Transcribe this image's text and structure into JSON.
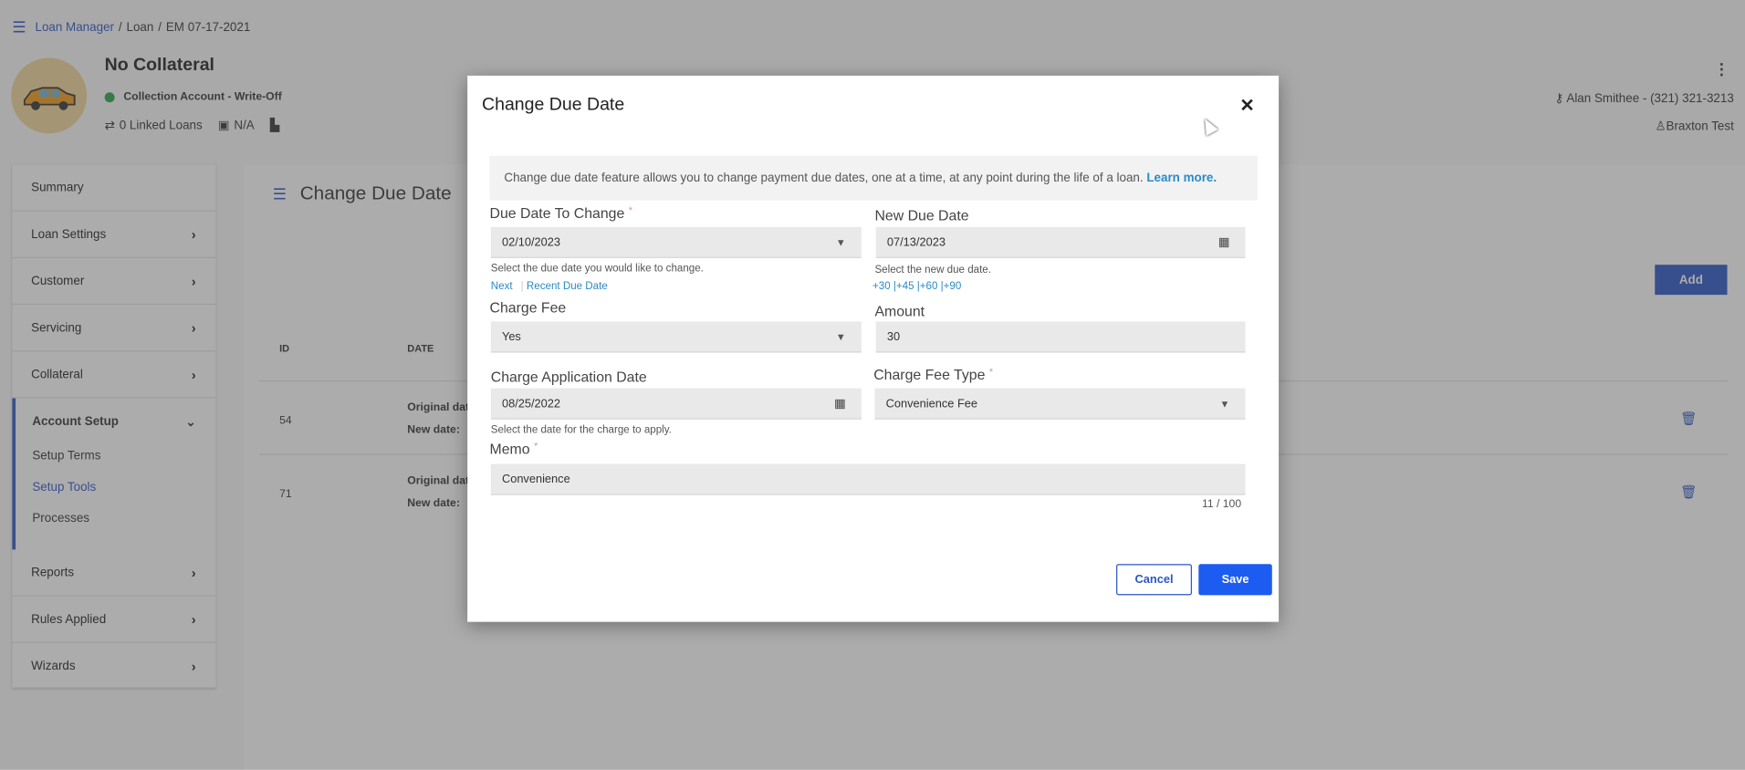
{
  "breadcrumb": {
    "root": "Loan Manager",
    "loan": "Loan",
    "current": "EM 07-17-2021"
  },
  "header": {
    "title": "No Collateral",
    "status": "Collection Account - Write-Off",
    "linked_loans": "0 Linked Loans",
    "date_value": "N/A",
    "owner": "Alan Smithee - (321) 321-3213",
    "user": "Braxton Test"
  },
  "sidebar": {
    "items": [
      {
        "label": "Summary"
      },
      {
        "label": "Loan Settings"
      },
      {
        "label": "Customer"
      },
      {
        "label": "Servicing"
      },
      {
        "label": "Collateral"
      }
    ],
    "active": {
      "label": "Account Setup",
      "subs": [
        "Setup Terms",
        "Setup Tools",
        "Processes"
      ]
    },
    "more": [
      {
        "label": "Reports"
      },
      {
        "label": "Rules Applied"
      },
      {
        "label": "Wizards"
      }
    ]
  },
  "main": {
    "title": "Change Due Date",
    "add_label": "Add",
    "columns": [
      "ID",
      "DATE"
    ],
    "rows": [
      {
        "id": "54",
        "l1": "Original date",
        "l2": "New date:"
      },
      {
        "id": "71",
        "l1": "Original date",
        "l2": "New date:"
      }
    ]
  },
  "modal": {
    "title": "Change Due Date",
    "info": "Change due date feature allows you to change payment due dates, one at a time, at any point during the life of a loan.",
    "info_link": "Learn more.",
    "due_date_label": "Due Date To Change",
    "due_date_value": "02/10/2023",
    "due_date_hint": "Select the due date you would like to change.",
    "next_link": "Next",
    "recent_link": "Recent Due Date",
    "new_due_label": "New Due Date",
    "new_due_value": "07/13/2023",
    "new_due_hint": "Select the new due date.",
    "quick_links": "+30 |+45 |+60 |+90",
    "charge_fee_label": "Charge Fee",
    "charge_fee_value": "Yes",
    "amount_label": "Amount",
    "amount_value": "30",
    "charge_app_label": "Charge Application Date",
    "charge_app_value": "08/25/2022",
    "charge_app_hint": "Select the date for the charge to apply.",
    "fee_type_label": "Charge Fee Type",
    "fee_type_value": "Convenience Fee",
    "memo_label": "Memo",
    "memo_value": "Convenience",
    "memo_counter": "11 / 100",
    "cancel_label": "Cancel",
    "save_label": "Save"
  }
}
